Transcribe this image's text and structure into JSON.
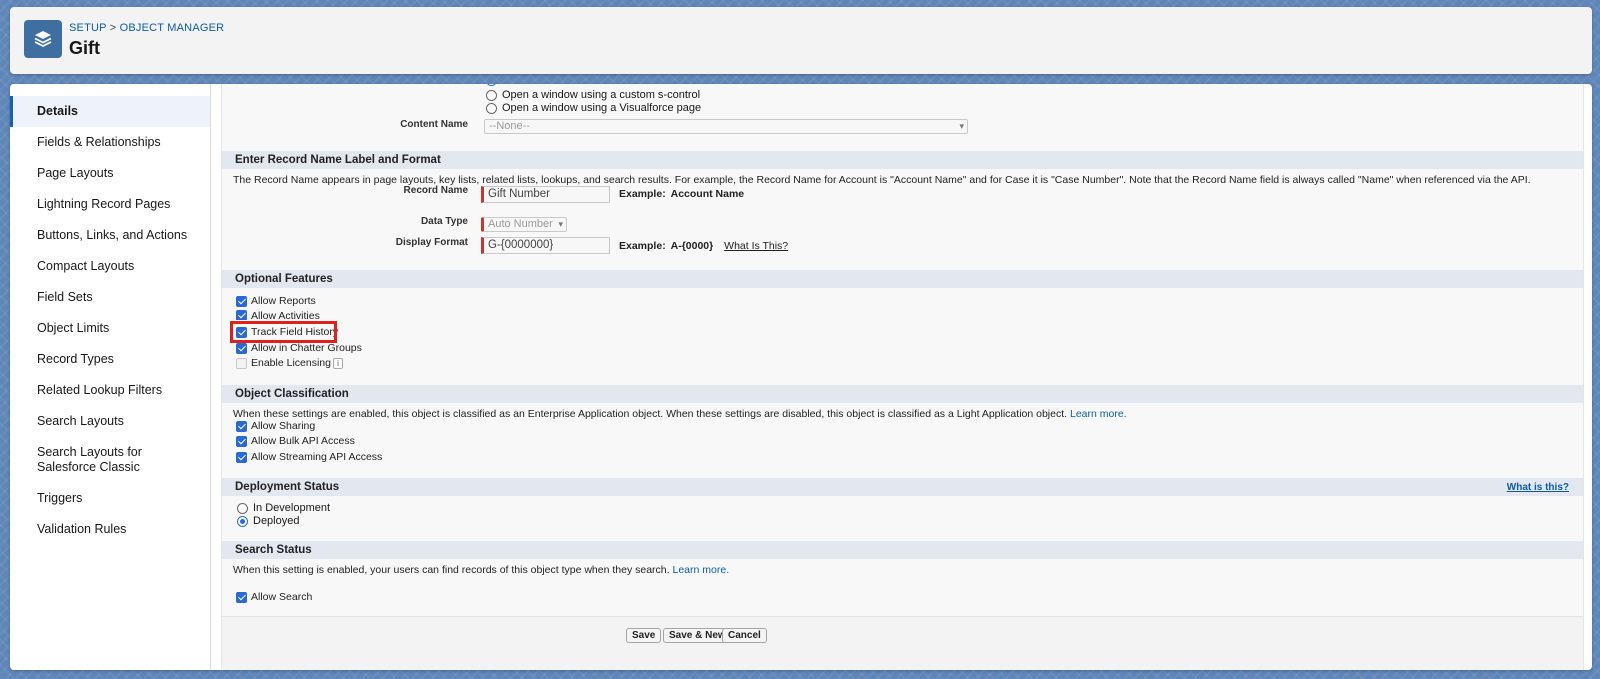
{
  "header": {
    "breadcrumb_setup": "SETUP",
    "breadcrumb_sep": " > ",
    "breadcrumb_object_manager": "OBJECT MANAGER",
    "title": "Gift",
    "icon": "layers-icon"
  },
  "sidebar": {
    "items": [
      {
        "label": "Details",
        "active": true
      },
      {
        "label": "Fields & Relationships"
      },
      {
        "label": "Page Layouts"
      },
      {
        "label": "Lightning Record Pages"
      },
      {
        "label": "Buttons, Links, and Actions"
      },
      {
        "label": "Compact Layouts"
      },
      {
        "label": "Field Sets"
      },
      {
        "label": "Object Limits"
      },
      {
        "label": "Record Types"
      },
      {
        "label": "Related Lookup Filters"
      },
      {
        "label": "Search Layouts"
      },
      {
        "label": "Search Layouts for Salesforce Classic"
      },
      {
        "label": "Triggers"
      },
      {
        "label": "Validation Rules"
      }
    ]
  },
  "help_settings": {
    "options": [
      "Open a window using a custom s-control",
      "Open a window using a Visualforce page"
    ],
    "content_name_label": "Content Name",
    "content_name_value": "--None--"
  },
  "record_name": {
    "section_title": "Enter Record Name Label and Format",
    "description": "The Record Name appears in page layouts, key lists, related lists, lookups, and search results. For example, the Record Name for Account is \"Account Name\" and for Case it is \"Case Number\". Note that the Record Name field is always called \"Name\" when referenced via the API.",
    "record_name_label": "Record Name",
    "record_name_value": "Gift Number",
    "record_name_example_label": "Example:",
    "record_name_example_value": "Account Name",
    "data_type_label": "Data Type",
    "data_type_value": "Auto Number",
    "display_format_label": "Display Format",
    "display_format_value": "G-{0000000}",
    "display_format_example_label": "Example:",
    "display_format_example_value": "A-{0000}",
    "what_is_this": "What Is This?"
  },
  "optional_features": {
    "section_title": "Optional Features",
    "items": [
      {
        "label": "Allow Reports",
        "checked": true
      },
      {
        "label": "Allow Activities",
        "checked": true
      },
      {
        "label": "Track Field History",
        "checked": true,
        "highlighted": true
      },
      {
        "label": "Allow in Chatter Groups",
        "checked": true
      },
      {
        "label": "Enable Licensing",
        "checked": false
      }
    ]
  },
  "object_classification": {
    "section_title": "Object Classification",
    "description": "When these settings are enabled, this object is classified as an Enterprise Application object. When these settings are disabled, this object is classified as a Light Application object.",
    "learn_more": "Learn more.",
    "items": [
      {
        "label": "Allow Sharing",
        "checked": true
      },
      {
        "label": "Allow Bulk API Access",
        "checked": true
      },
      {
        "label": "Allow Streaming API Access",
        "checked": true
      }
    ]
  },
  "deployment_status": {
    "section_title": "Deployment Status",
    "what_is_this": "What is this?",
    "options": [
      {
        "label": "In Development",
        "selected": false
      },
      {
        "label": "Deployed",
        "selected": true
      }
    ]
  },
  "search_status": {
    "section_title": "Search Status",
    "description": "When this setting is enabled, your users can find records of this object type when they search.",
    "learn_more": "Learn more.",
    "allow_search_label": "Allow Search",
    "allow_search_checked": true
  },
  "buttons": {
    "save": "Save",
    "save_new": "Save & New",
    "cancel": "Cancel"
  },
  "colors": {
    "highlight": "#e0201b",
    "accent": "#2a6ad4",
    "link": "#0b5cab"
  }
}
